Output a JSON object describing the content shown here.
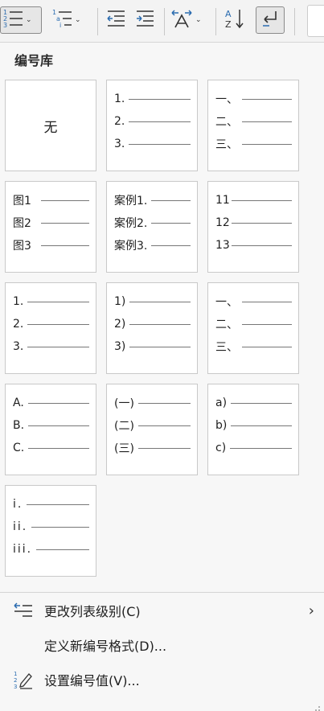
{
  "panel": {
    "title": "编号库"
  },
  "tiles": [
    {
      "none_label": "无"
    },
    {
      "rows": [
        "1.",
        "2.",
        "3."
      ]
    },
    {
      "rows": [
        "一、",
        "二、",
        "三、"
      ]
    },
    {
      "rows": [
        "图1",
        "图2",
        "图3"
      ]
    },
    {
      "rows": [
        "案例1.",
        "案例2.",
        "案例3."
      ]
    },
    {
      "rows": [
        "11",
        "12",
        "13"
      ]
    },
    {
      "rows": [
        "1.",
        "2.",
        "3."
      ]
    },
    {
      "rows": [
        "1)",
        "2)",
        "3)"
      ]
    },
    {
      "rows": [
        "一、",
        "二、",
        "三、"
      ]
    },
    {
      "rows": [
        "A.",
        "B.",
        "C."
      ]
    },
    {
      "rows": [
        "(一)",
        "(二)",
        "(三)"
      ]
    },
    {
      "rows": [
        "a)",
        "b)",
        "c)"
      ]
    },
    {
      "rows": [
        "i.",
        "ii.",
        "iii."
      ]
    }
  ],
  "menu": {
    "change_level": "更改列表级别(C)",
    "define_format": "定义新编号格式(D)...",
    "set_value": "设置编号值(V)..."
  },
  "icons": {
    "numbering": "numbered-list-icon",
    "multilevel": "multilevel-list-icon",
    "decrease_indent": "decrease-indent-icon",
    "increase_indent": "increase-indent-icon",
    "spacing": "character-spacing-icon",
    "sort": "sort-az-icon",
    "return": "return-arrow-icon"
  },
  "colors": {
    "accent": "#2b6cb0",
    "tile_border": "#c9c9c9"
  }
}
